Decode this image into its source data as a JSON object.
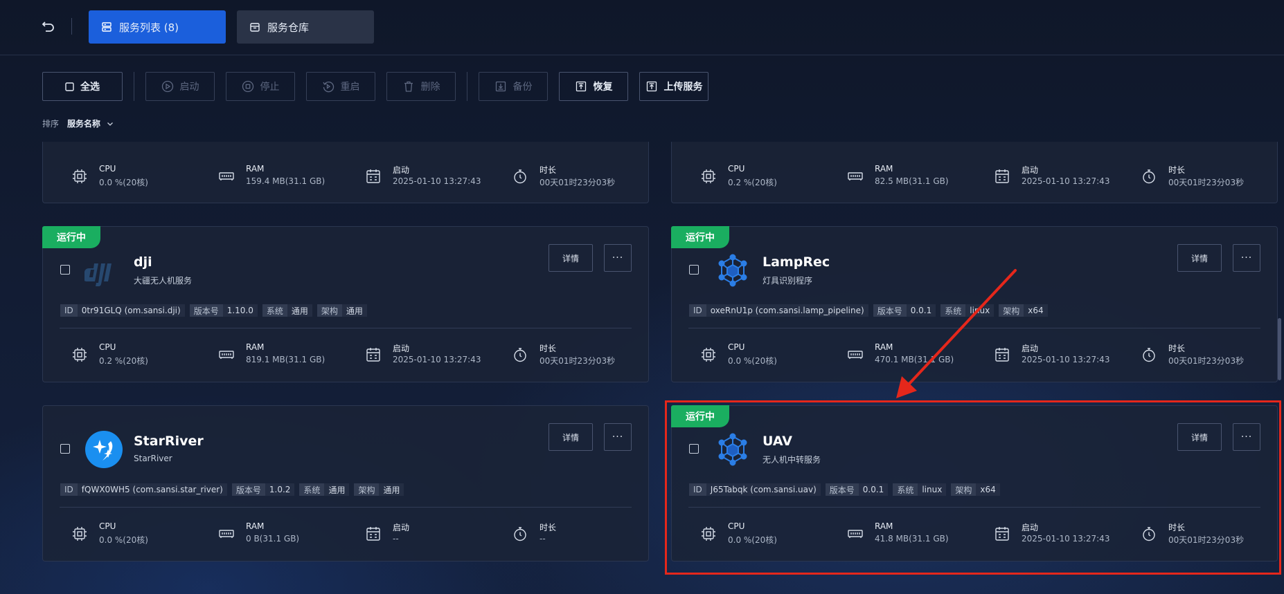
{
  "tabs": {
    "services_label": "服务列表 (8)",
    "warehouse_label": "服务仓库"
  },
  "toolbar": {
    "select_all": "全选",
    "start": "启动",
    "stop": "停止",
    "restart": "重启",
    "delete": "删除",
    "backup": "备份",
    "restore": "恢复",
    "upload": "上传服务"
  },
  "sort": {
    "label": "排序",
    "value": "服务名称"
  },
  "colors": {
    "accent": "#1b5fdc",
    "running": "#1aae60",
    "annotation": "#e5271b"
  },
  "labels": {
    "running": "运行中",
    "detail": "详情",
    "more": "···",
    "id": "ID",
    "version": "版本号",
    "system": "系统",
    "arch": "架构",
    "cpu": "CPU",
    "ram": "RAM",
    "start": "启动",
    "duration": "时长"
  },
  "partial": [
    {
      "cpu": "0.0 %(20核)",
      "ram": "159.4 MB(31.1 GB)",
      "start": "2025-01-10 13:27:43",
      "duration": "00天01时23分03秒"
    },
    {
      "cpu": "0.2 %(20核)",
      "ram": "82.5 MB(31.1 GB)",
      "start": "2025-01-10 13:27:43",
      "duration": "00天01时23分03秒"
    }
  ],
  "services": [
    {
      "name": "dji",
      "desc": "大疆无人机服务",
      "logo": "dji-logo",
      "id": "0tr91GLQ (om.sansi.dji)",
      "version": "1.10.0",
      "system": "通用",
      "arch": "通用",
      "cpu": "0.2 %(20核)",
      "ram": "819.1 MB(31.1 GB)",
      "start": "2025-01-10 13:27:43",
      "duration": "00天01时23分03秒",
      "running": true
    },
    {
      "name": "LampRec",
      "desc": "灯具识别程序",
      "logo": "cube-network-icon",
      "id": "oxeRnU1p (com.sansi.lamp_pipeline)",
      "version": "0.0.1",
      "system": "linux",
      "arch": "x64",
      "cpu": "0.0 %(20核)",
      "ram": "470.1 MB(31.1 GB)",
      "start": "2025-01-10 13:27:43",
      "duration": "00天01时23分03秒",
      "running": true
    },
    {
      "name": "StarRiver",
      "desc": "StarRiver",
      "logo": "star-river-logo",
      "id": "fQWX0WH5 (com.sansi.star_river)",
      "version": "1.0.2",
      "system": "通用",
      "arch": "通用",
      "cpu": "0.0 %(20核)",
      "ram": "0 B(31.1 GB)",
      "start": "--",
      "duration": "--",
      "running": false
    },
    {
      "name": "UAV",
      "desc": "无人机中转服务",
      "logo": "cube-network-icon",
      "id": "J65Tabqk (com.sansi.uav)",
      "version": "0.0.1",
      "system": "linux",
      "arch": "x64",
      "cpu": "0.0 %(20核)",
      "ram": "41.8 MB(31.1 GB)",
      "start": "2025-01-10 13:27:43",
      "duration": "00天01时23分03秒",
      "running": true
    }
  ]
}
